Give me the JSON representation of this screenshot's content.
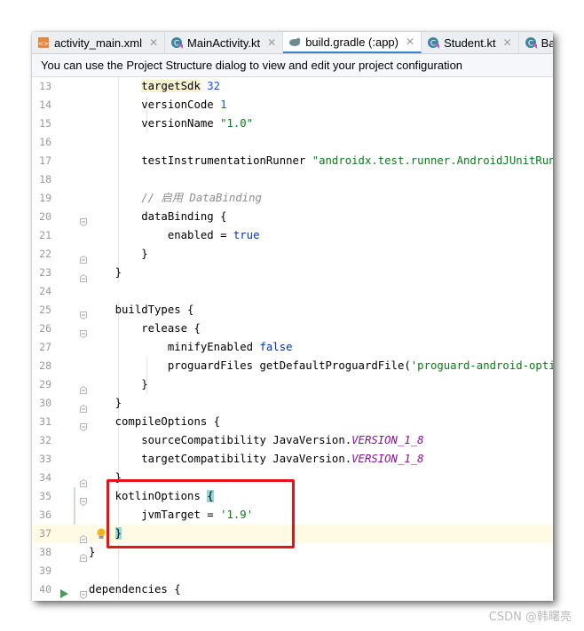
{
  "tabs": [
    {
      "label": "activity_main.xml",
      "icon": "xml-file-icon",
      "active": false
    },
    {
      "label": "MainActivity.kt",
      "icon": "kotlin-class-icon",
      "active": false
    },
    {
      "label": "build.gradle (:app)",
      "icon": "gradle-elephant-icon",
      "active": true
    },
    {
      "label": "Student.kt",
      "icon": "kotlin-class-icon",
      "active": false
    },
    {
      "label": "Ba",
      "icon": "kotlin-class-icon",
      "active": false
    }
  ],
  "banner": {
    "text": "You can use the Project Structure dialog to view and edit your project configuration"
  },
  "lines": [
    {
      "n": "13",
      "code": "        targetSdk 32"
    },
    {
      "n": "14",
      "code": "        versionCode 1"
    },
    {
      "n": "15",
      "code": "        versionName \"1.0\""
    },
    {
      "n": "16",
      "code": ""
    },
    {
      "n": "17",
      "code": "        testInstrumentationRunner \"androidx.test.runner.AndroidJUnitRunner\""
    },
    {
      "n": "18",
      "code": ""
    },
    {
      "n": "19",
      "code": "        // 启用 DataBinding"
    },
    {
      "n": "20",
      "code": "        dataBinding {"
    },
    {
      "n": "21",
      "code": "            enabled = true"
    },
    {
      "n": "22",
      "code": "        }"
    },
    {
      "n": "23",
      "code": "    }"
    },
    {
      "n": "24",
      "code": ""
    },
    {
      "n": "25",
      "code": "    buildTypes {"
    },
    {
      "n": "26",
      "code": "        release {"
    },
    {
      "n": "27",
      "code": "            minifyEnabled false"
    },
    {
      "n": "28",
      "code": "            proguardFiles getDefaultProguardFile('proguard-android-optimize.txt')"
    },
    {
      "n": "29",
      "code": "        }"
    },
    {
      "n": "30",
      "code": "    }"
    },
    {
      "n": "31",
      "code": "    compileOptions {"
    },
    {
      "n": "32",
      "code": "        sourceCompatibility JavaVersion.VERSION_1_8"
    },
    {
      "n": "33",
      "code": "        targetCompatibility JavaVersion.VERSION_1_8"
    },
    {
      "n": "34",
      "code": "    }"
    },
    {
      "n": "35",
      "code": "    kotlinOptions {"
    },
    {
      "n": "36",
      "code": "        jvmTarget = '1.9'"
    },
    {
      "n": "37",
      "code": "    }"
    },
    {
      "n": "38",
      "code": "}"
    },
    {
      "n": "39",
      "code": ""
    },
    {
      "n": "40",
      "code": "dependencies {"
    }
  ],
  "watermark": "CSDN @韩曙亮",
  "colors": {
    "highlight_box": "#e8121a",
    "active_tab_underline": "#4083c9",
    "brace_match": "#93d9d9"
  }
}
